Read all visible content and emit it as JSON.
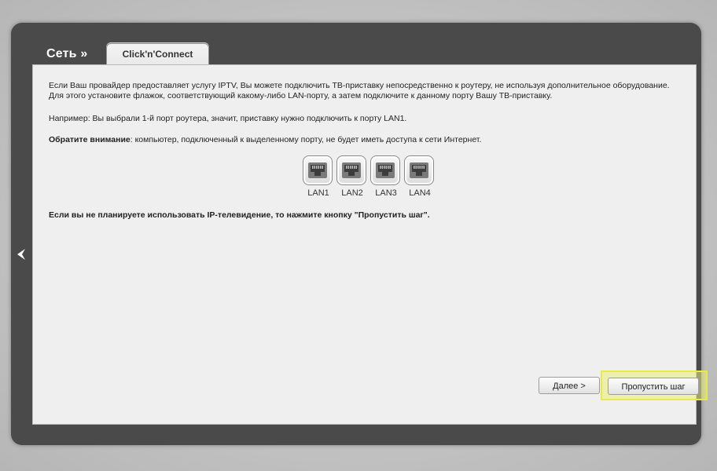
{
  "header": {
    "section_title": "Сеть »",
    "tab_label": "Click'n'Connect"
  },
  "content": {
    "paragraph1": "Если Ваш провайдер предоставляет услугу IPTV, Вы можете подключить ТВ-приставку непосредственно к роутеру, не используя дополнительное оборудование. Для этого установите флажок, соответствующий какому-либо LAN-порту, а затем подключите к данному порту Вашу ТВ-приставку.",
    "paragraph2": "Например: Вы выбрали 1-й порт роутера, значит, приставку нужно подключить к порту LAN1.",
    "notice_bold": "Обратите внимание",
    "notice_rest": ": компьютер, подключенный к выделенному порту, не будет иметь доступа к сети Интернет.",
    "skip_hint": "Если вы не планируете использовать IP-телевидение, то нажмите кнопку \"Пропустить шаг\"."
  },
  "ports": [
    {
      "label": "LAN1",
      "icon": "ethernet-port-icon"
    },
    {
      "label": "LAN2",
      "icon": "ethernet-port-icon"
    },
    {
      "label": "LAN3",
      "icon": "ethernet-port-icon"
    },
    {
      "label": "LAN4",
      "icon": "ethernet-port-icon"
    }
  ],
  "nav": {
    "back_icon": "chevron-left-icon"
  },
  "buttons": {
    "next_label": "Далее >",
    "skip_label": "Пропустить шаг"
  },
  "colors": {
    "frame": "#4a4a4a",
    "panel": "#efefef",
    "highlight": "#e8ea4a"
  }
}
